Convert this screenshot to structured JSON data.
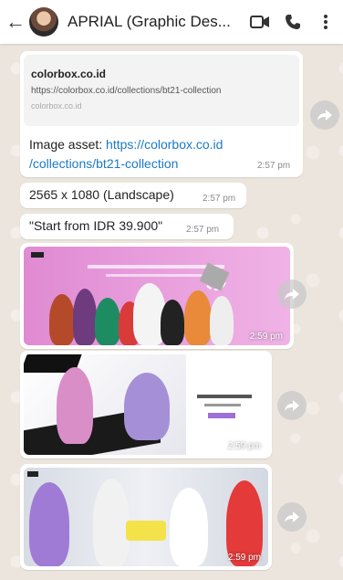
{
  "header": {
    "title": "APRIAL (Graphic Des...",
    "back_icon": "arrow-left-icon",
    "video_icon": "video-call-icon",
    "call_icon": "phone-icon",
    "menu_icon": "more-vertical-icon"
  },
  "link_preview": {
    "site": "colorbox.co.id",
    "url": "https://colorbox.co.id/collections/bt21-collection",
    "domain": "colorbox.co.id"
  },
  "messages": [
    {
      "prefix": "Image asset: ",
      "link": "https://colorbox.co.id/collections/bt21-collection",
      "link_line1": "https://colorbox.co.id",
      "link_line2": "/collections/bt21-collection",
      "time": "2:57 pm"
    },
    {
      "text": "2565 x 1080 (Landscape)",
      "time": "2:57 pm"
    },
    {
      "text": "\"Start from IDR 39.900\"",
      "time": "2:57 pm"
    }
  ],
  "images": [
    {
      "time": "2:59 pm"
    },
    {
      "time": "2:59 pm"
    },
    {
      "time": "2:59 pm"
    }
  ],
  "colors": {
    "header_bg": "#ffffff",
    "chat_bg": "#ece5dd",
    "link": "#1b7ac7",
    "image1_bg": "#e89ad6"
  }
}
